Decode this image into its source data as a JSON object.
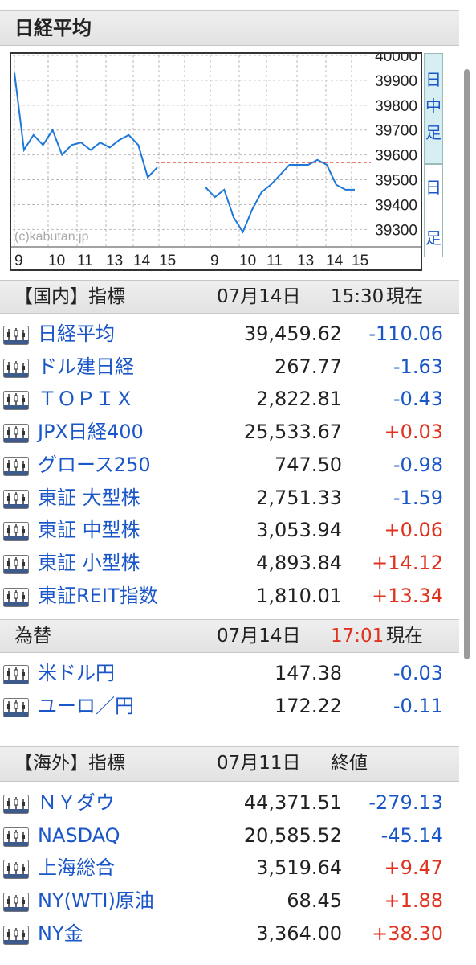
{
  "title": "日経平均",
  "chart": {
    "watermark": "(c)kabutan.jp",
    "y_ticks": [
      "40000",
      "39900",
      "39800",
      "39700",
      "39600",
      "39500",
      "39400",
      "39300"
    ],
    "x_ticks": [
      "9",
      "10",
      "11",
      "13",
      "14",
      "15",
      "9",
      "10",
      "11",
      "13",
      "14",
      "15"
    ],
    "side_top": [
      "日",
      "中",
      "足"
    ],
    "side_bottom": [
      "日",
      "足"
    ]
  },
  "chart_data": {
    "type": "line",
    "title": "日経平均",
    "xlabel": "",
    "ylabel": "",
    "x": [
      "9",
      "10",
      "11",
      "13",
      "14",
      "15",
      "9",
      "10",
      "11",
      "13",
      "14",
      "15"
    ],
    "ylim": [
      39230,
      40000
    ],
    "reference_line": 39570,
    "series": [
      {
        "values_day1": [
          39930,
          39620,
          39680,
          39640,
          39700,
          39600,
          39640,
          39650,
          39620,
          39650,
          39630,
          39660,
          39680,
          39640,
          39510,
          39550
        ],
        "values_day2": [
          39470,
          39430,
          39460,
          39350,
          39290,
          39380,
          39450,
          39480,
          39520,
          39560,
          39560,
          39560,
          39580,
          39560,
          39480,
          39460,
          39460
        ]
      }
    ]
  },
  "domestic": {
    "header_label": "【国内】指標",
    "date": "07月14日",
    "time": "15:30",
    "status": "現在",
    "rows": [
      {
        "name": "日経平均",
        "value": "39,459.62",
        "change": "-110.06",
        "dir": "down"
      },
      {
        "name": "ドル建日経",
        "value": "267.77",
        "change": "-1.63",
        "dir": "down"
      },
      {
        "name": "ＴＯＰＩＸ",
        "value": "2,822.81",
        "change": "-0.43",
        "dir": "down"
      },
      {
        "name": "JPX日経400",
        "value": "25,533.67",
        "change": "+0.03",
        "dir": "up"
      },
      {
        "name": "グロース250",
        "value": "747.50",
        "change": "-0.98",
        "dir": "down"
      },
      {
        "name": "東証 大型株",
        "value": "2,751.33",
        "change": "-1.59",
        "dir": "down"
      },
      {
        "name": "東証 中型株",
        "value": "3,053.94",
        "change": "+0.06",
        "dir": "up"
      },
      {
        "name": "東証 小型株",
        "value": "4,893.84",
        "change": "+14.12",
        "dir": "up"
      },
      {
        "name": "東証REIT指数",
        "value": "1,810.01",
        "change": "+13.34",
        "dir": "up"
      }
    ]
  },
  "fx": {
    "header_label": "為替",
    "date": "07月14日",
    "time": "17:01",
    "status": "現在",
    "rows": [
      {
        "name": "米ドル円",
        "value": "147.38",
        "change": "-0.03",
        "dir": "down"
      },
      {
        "name": "ユーロ／円",
        "value": "172.22",
        "change": "-0.11",
        "dir": "down"
      }
    ]
  },
  "overseas": {
    "header_label": "【海外】指標",
    "date": "07月11日",
    "status": "終値",
    "rows": [
      {
        "name": "ＮＹダウ",
        "value": "44,371.51",
        "change": "-279.13",
        "dir": "down"
      },
      {
        "name": "NASDAQ",
        "value": "20,585.52",
        "change": "-45.14",
        "dir": "down"
      },
      {
        "name": "上海総合",
        "value": "3,519.64",
        "change": "+9.47",
        "dir": "up"
      },
      {
        "name": "NY(WTI)原油",
        "value": "68.45",
        "change": "+1.88",
        "dir": "up"
      },
      {
        "name": "NY金",
        "value": "3,364.00",
        "change": "+38.30",
        "dir": "up"
      }
    ]
  },
  "colors": {
    "up": "#e0321e",
    "down": "#1a56c8",
    "name": "#1a56c8"
  }
}
